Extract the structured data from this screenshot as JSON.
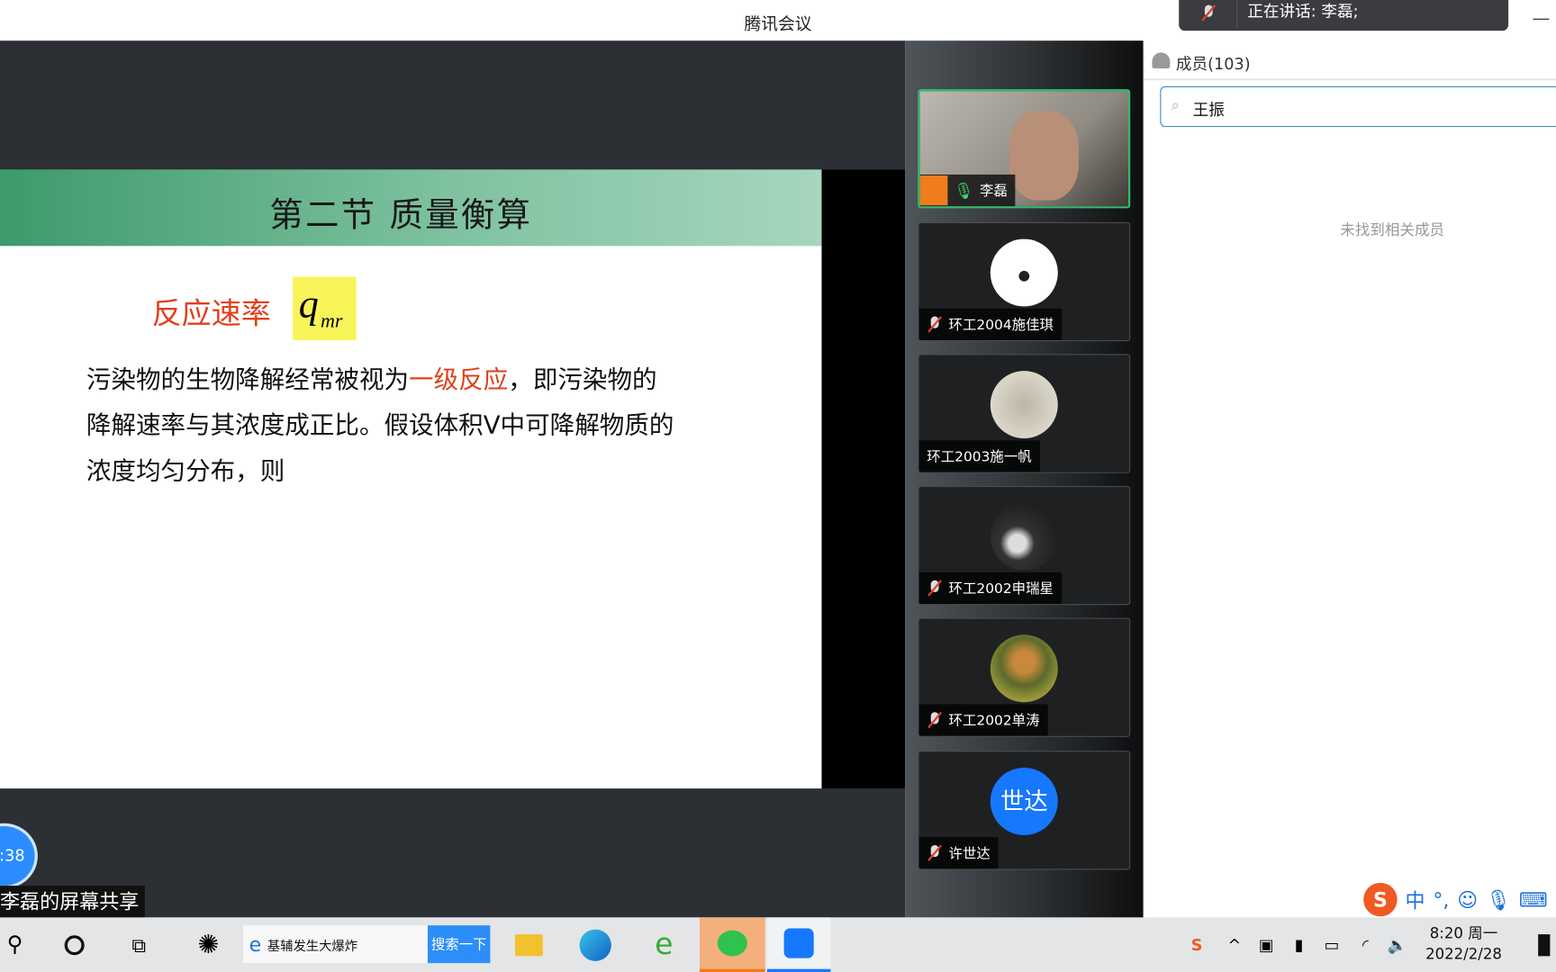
{
  "window": {
    "title": "腾讯会议",
    "minimize": "—"
  },
  "speaking_toast": {
    "text": "正在讲话: 李磊;"
  },
  "slide": {
    "title": "第二节  质量衡算",
    "rate_label": "反应速率",
    "symbol": "q",
    "symbol_sub": "mr",
    "para1a": "污染物的生物降解经常被视为",
    "para1b": "一级反应",
    "para1c": "，即污染物的",
    "para2": "降解速率与其浓度成正比。假设体积V中可降解物质的",
    "para3": "浓度均匀分布，则",
    "colors": {
      "accent": "#e0401c",
      "highlight": "#f7f55a",
      "header": "#3d9a6b"
    }
  },
  "participants": [
    {
      "name": "李磊",
      "mic": "on",
      "video": true
    },
    {
      "name": "环工2004施佳琪",
      "mic": "off"
    },
    {
      "name": "环工2003施一帆",
      "mic": "none"
    },
    {
      "name": "环工2002申瑞星",
      "mic": "off"
    },
    {
      "name": "环工2002单涛",
      "mic": "off"
    },
    {
      "name": "许世达",
      "mic": "off",
      "avatar_text": "世达"
    }
  ],
  "panel": {
    "header": "成员(103)",
    "search_value": "王振",
    "empty_text": "未找到相关成员"
  },
  "share": {
    "timer": ":38",
    "label": "李磊的屏幕共享"
  },
  "ime": {
    "mode": "中",
    "punct": "°,"
  },
  "taskbar": {
    "search_text": "基辅发生大爆炸",
    "search_button": "搜索一下",
    "time": "8:20 周一",
    "date": "2022/2/28"
  }
}
